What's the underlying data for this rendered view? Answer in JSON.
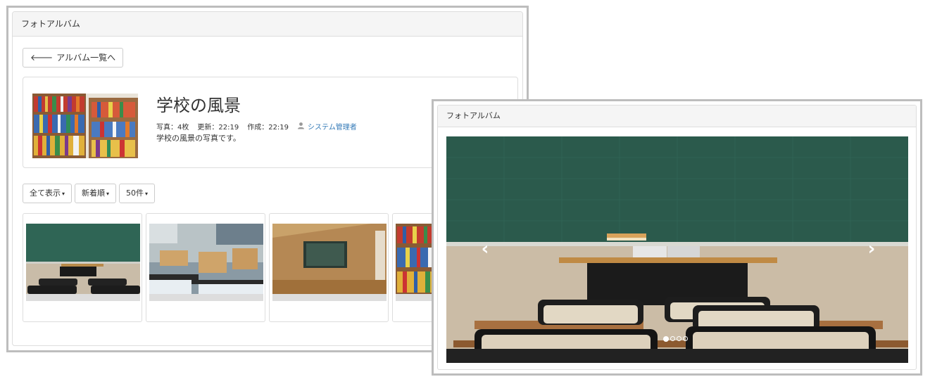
{
  "album_window": {
    "header_title": "フォトアルバム",
    "back_button_label": "アルバム一覧へ",
    "album": {
      "title": "学校の風景",
      "meta_photos": "写真：4枚",
      "meta_updated": "更新：22:19",
      "meta_created": "作成：22:19",
      "owner": "システム管理者",
      "description": "学校の風景の写真です。"
    },
    "filters": {
      "display": "全て表示",
      "sort": "新着順",
      "count": "50件"
    },
    "thumbnails": [
      {
        "subject": "classroom-chalkboard"
      },
      {
        "subject": "science-lab"
      },
      {
        "subject": "classroom-corridor"
      },
      {
        "subject": "library-bookshelf"
      }
    ]
  },
  "slideshow_window": {
    "header_title": "フォトアルバム",
    "indicators": {
      "total": 4,
      "active_index": 0
    },
    "prev_icon": "chevron-left-icon",
    "next_icon": "chevron-right-icon"
  },
  "colors": {
    "link": "#337ab7",
    "panel_header_bg": "#f5f5f5",
    "border": "#dddddd",
    "chalkboard": "#2b5a4c"
  }
}
